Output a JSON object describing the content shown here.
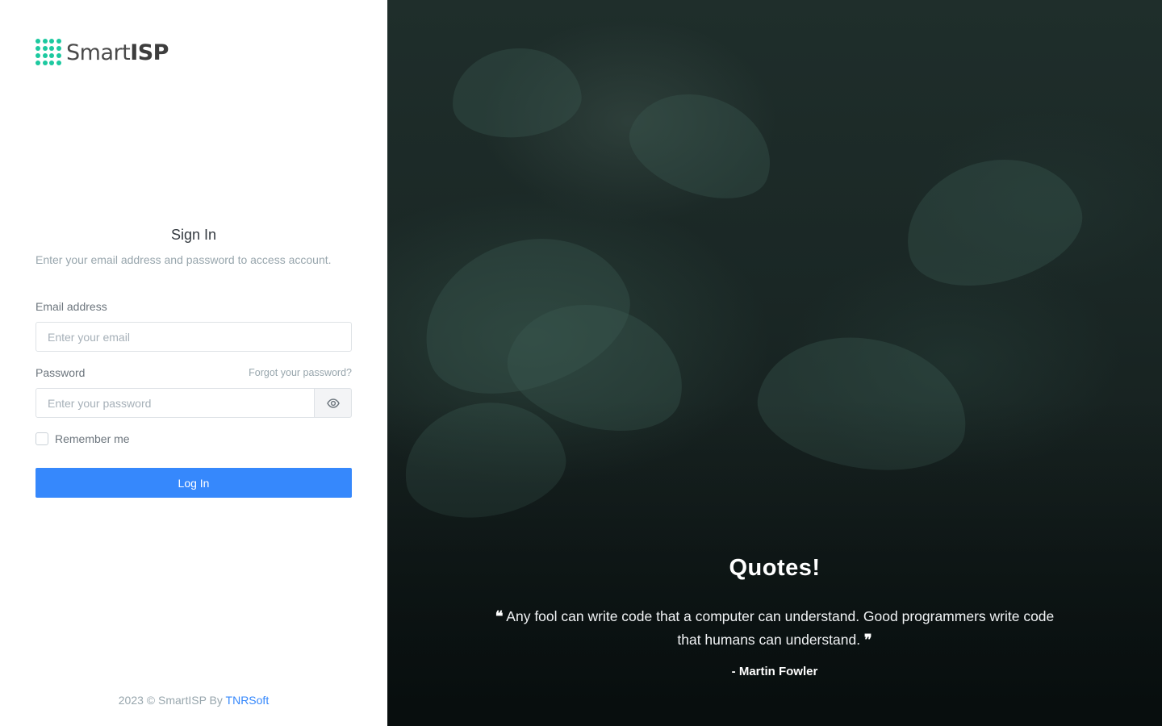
{
  "brand": {
    "name_prefix": "Smart",
    "name_suffix": "ISP",
    "accent": "#1dc9a0"
  },
  "signin": {
    "title": "Sign In",
    "subtitle": "Enter your email address and password to access account.",
    "email_label": "Email address",
    "email_placeholder": "Enter your email",
    "password_label": "Password",
    "forgot_link": "Forgot your password?",
    "password_placeholder": "Enter your password",
    "show_password_icon": "eye-icon",
    "remember_label": "Remember me",
    "login_button": "Log In",
    "button_color": "#3688fc"
  },
  "footer": {
    "text": "2023 © SmartISP By ",
    "link": "TNRSoft"
  },
  "quotes": {
    "title": "Quotes!",
    "open_mark": "❝",
    "text": " Any fool can write code that a computer can understand. Good programmers write code that humans can understand. ",
    "close_mark": "❞",
    "author": "- Martin Fowler"
  }
}
